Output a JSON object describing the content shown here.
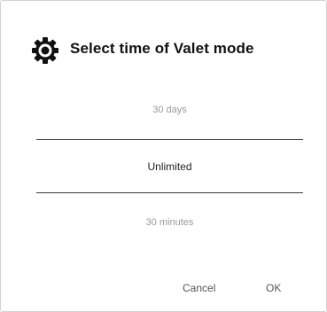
{
  "dialog": {
    "title": "Select time of Valet mode",
    "icon": "gear-icon"
  },
  "picker": {
    "options": [
      "30 days",
      "Unlimited",
      "30 minutes"
    ],
    "selected": "Unlimited"
  },
  "actions": {
    "cancel_label": "Cancel",
    "ok_label": "OK"
  },
  "colors": {
    "title": "#111111",
    "selected_option": "#222222",
    "unselected_option": "#9a9a9a",
    "divider": "#3a3a3a",
    "button_text": "#555555"
  }
}
